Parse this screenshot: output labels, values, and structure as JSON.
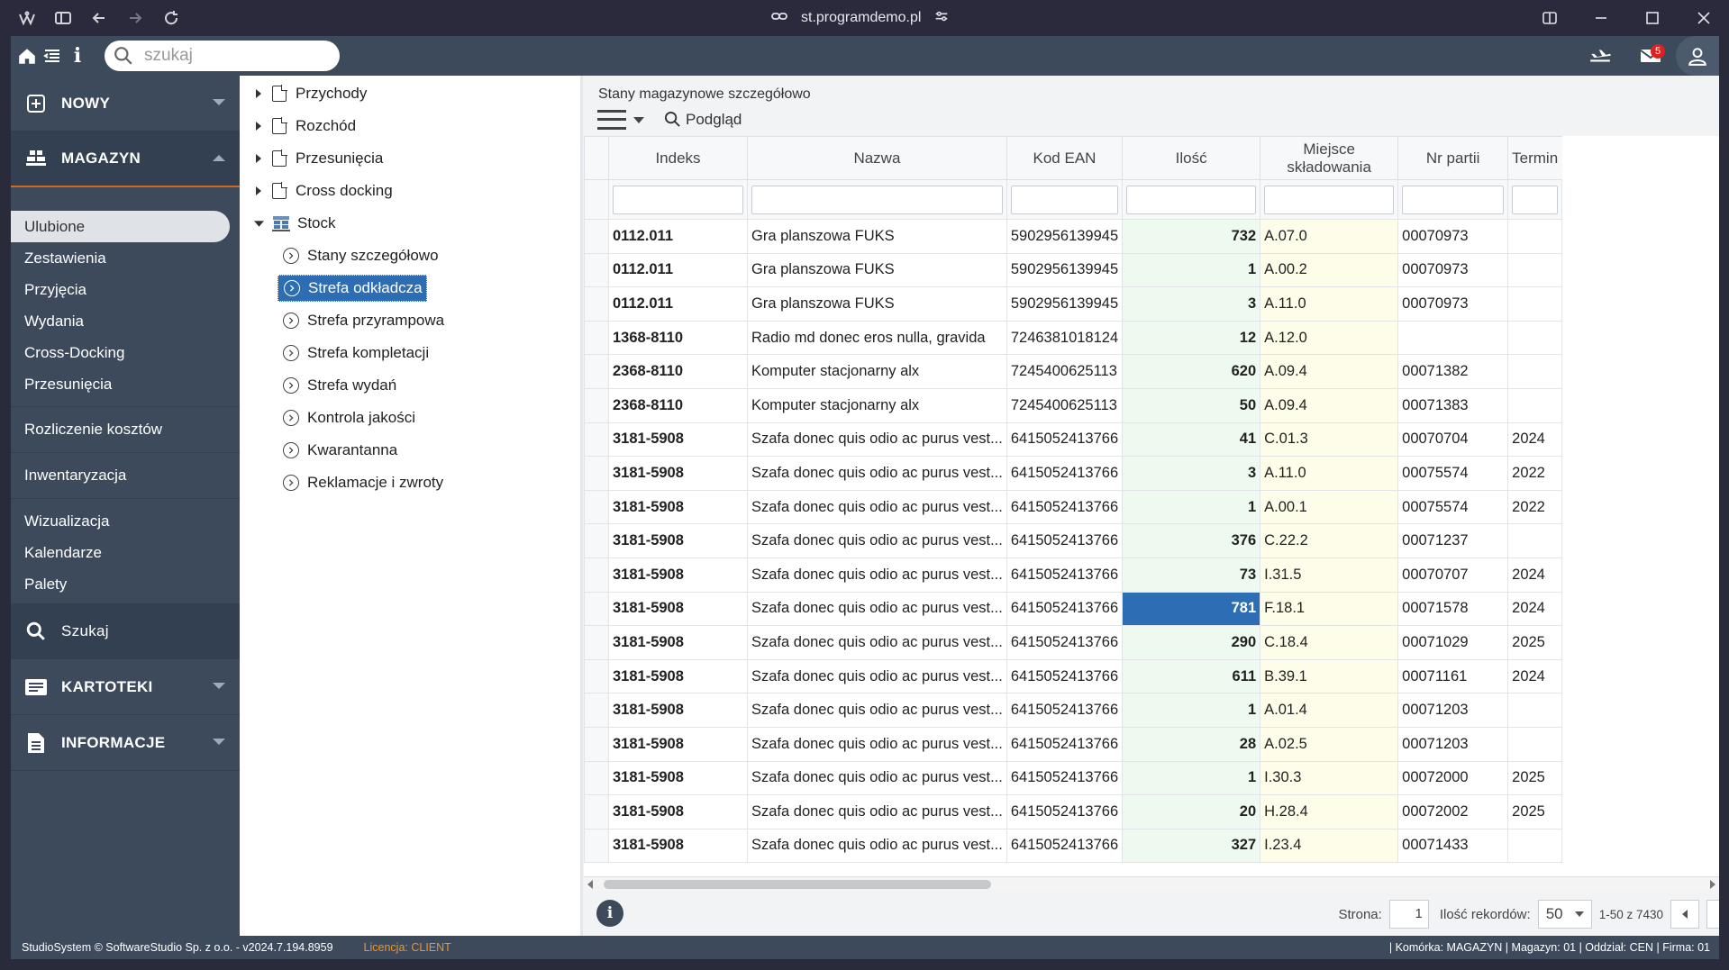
{
  "browser": {
    "url": "st.programdemo.pl"
  },
  "appbar": {
    "search_placeholder": "szukaj",
    "mail_count": "5"
  },
  "sidebar": {
    "nowy": "NOWY",
    "magazyn": "MAGAZYN",
    "items_group1": [
      "Ulubione",
      "Zestawienia",
      "Przyjęcia",
      "Wydania",
      "Cross-Docking",
      "Przesunięcia"
    ],
    "rozliczenie": "Rozliczenie kosztów",
    "inwentaryzacja": "Inwentaryzacja",
    "items_group2": [
      "Wizualizacja",
      "Kalendarze",
      "Palety"
    ],
    "szukaj": "Szukaj",
    "kartoteki": "KARTOTEKI",
    "informacje": "INFORMACJE"
  },
  "tree": {
    "przychody": "Przychody",
    "rozchod": "Rozchód",
    "przesuniecia": "Przesunięcia",
    "cross_docking": "Cross docking",
    "stock": "Stock",
    "stock_children": [
      "Stany szczegółowo",
      "Strefa odkładcza",
      "Strefa przyrampowa",
      "Strefa kompletacji",
      "Strefa wydań",
      "Kontrola jakości",
      "Kwarantanna",
      "Reklamacje i zwroty"
    ],
    "selected_index": 1
  },
  "main": {
    "title": "Stany magazynowe szczegółowo",
    "preview_label": "Podgląd"
  },
  "grid": {
    "columns": [
      "Indeks",
      "Nazwa",
      "Kod EAN",
      "Ilość",
      "Miejsce składowania",
      "Nr partii",
      "Termin"
    ],
    "rows": [
      [
        "0112.011",
        "Gra planszowa FUKS",
        "5902956139945",
        "732",
        "A.07.0",
        "00070973",
        ""
      ],
      [
        "0112.011",
        "Gra planszowa FUKS",
        "5902956139945",
        "1",
        "A.00.2",
        "00070973",
        ""
      ],
      [
        "0112.011",
        "Gra planszowa FUKS",
        "5902956139945",
        "3",
        "A.11.0",
        "00070973",
        ""
      ],
      [
        "1368-8110",
        "Radio md donec eros nulla, gravida",
        "7246381018124",
        "12",
        "A.12.0",
        "",
        ""
      ],
      [
        "2368-8110",
        "Komputer stacjonarny alx",
        "7245400625113",
        "620",
        "A.09.4",
        "00071382",
        ""
      ],
      [
        "2368-8110",
        "Komputer stacjonarny alx",
        "7245400625113",
        "50",
        "A.09.4",
        "00071383",
        ""
      ],
      [
        "3181-5908",
        "Szafa donec quis odio ac purus vest...",
        "6415052413766",
        "41",
        "C.01.3",
        "00070704",
        "2024"
      ],
      [
        "3181-5908",
        "Szafa donec quis odio ac purus vest...",
        "6415052413766",
        "3",
        "A.11.0",
        "00075574",
        "2022"
      ],
      [
        "3181-5908",
        "Szafa donec quis odio ac purus vest...",
        "6415052413766",
        "1",
        "A.00.1",
        "00075574",
        "2022"
      ],
      [
        "3181-5908",
        "Szafa donec quis odio ac purus vest...",
        "6415052413766",
        "376",
        "C.22.2",
        "00071237",
        ""
      ],
      [
        "3181-5908",
        "Szafa donec quis odio ac purus vest...",
        "6415052413766",
        "73",
        "I.31.5",
        "00070707",
        "2024"
      ],
      [
        "3181-5908",
        "Szafa donec quis odio ac purus vest...",
        "6415052413766",
        "781",
        "F.18.1",
        "00071578",
        "2024"
      ],
      [
        "3181-5908",
        "Szafa donec quis odio ac purus vest...",
        "6415052413766",
        "290",
        "C.18.4",
        "00071029",
        "2025"
      ],
      [
        "3181-5908",
        "Szafa donec quis odio ac purus vest...",
        "6415052413766",
        "611",
        "B.39.1",
        "00071161",
        "2024"
      ],
      [
        "3181-5908",
        "Szafa donec quis odio ac purus vest...",
        "6415052413766",
        "1",
        "A.01.4",
        "00071203",
        ""
      ],
      [
        "3181-5908",
        "Szafa donec quis odio ac purus vest...",
        "6415052413766",
        "28",
        "A.02.5",
        "00071203",
        ""
      ],
      [
        "3181-5908",
        "Szafa donec quis odio ac purus vest...",
        "6415052413766",
        "1",
        "I.30.3",
        "00072000",
        "2025"
      ],
      [
        "3181-5908",
        "Szafa donec quis odio ac purus vest...",
        "6415052413766",
        "20",
        "H.28.4",
        "00072002",
        "2025"
      ],
      [
        "3181-5908",
        "Szafa donec quis odio ac purus vest...",
        "6415052413766",
        "327",
        "I.23.4",
        "00071433",
        ""
      ]
    ],
    "selected_row": 11
  },
  "footer": {
    "page_label": "Strona:",
    "page_value": "1",
    "records_label": "Ilość rekordów:",
    "records_value": "50",
    "range_text": "1-50 z 7430"
  },
  "status": {
    "copyright": "StudioSystem © SoftwareStudio Sp. z o.o. - v2024.7.194.8959",
    "license": "Licencja: CLIENT",
    "right": "| Komórka: MAGAZYN | Magazyn: 01 | Oddział: CEN | Firma: 01"
  }
}
